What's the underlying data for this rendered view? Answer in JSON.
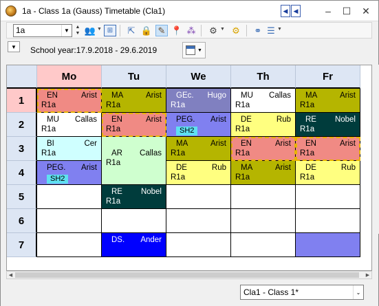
{
  "window": {
    "title": "1a - Class 1a (Gauss)  Timetable  (Cla1)",
    "nav_prev": "◀",
    "nav_next": "◀",
    "minimize": "–",
    "maximize": "☐",
    "close": "✕"
  },
  "toolbar": {
    "element_value": "1a",
    "icons": [
      "people-icon",
      "export-icon",
      "lock-icon",
      "edit-icon",
      "pin-icon",
      "molecule-icon",
      "settings-icon",
      "gear-icon",
      "binoculars-icon",
      "list-icon"
    ]
  },
  "info": {
    "school_year": "School year:17.9.2018 - 29.6.2019"
  },
  "timetable": {
    "days": [
      "Mo",
      "Tu",
      "We",
      "Th",
      "Fr"
    ],
    "periods": [
      "1",
      "2",
      "3",
      "4",
      "5",
      "6",
      "7"
    ],
    "lessons": [
      {
        "day": 0,
        "start": 0,
        "span": 1,
        "subject": "EN",
        "teacher": "Arist",
        "room": "R1a",
        "color": "#f08a84",
        "dashed": true
      },
      {
        "day": 0,
        "start": 1,
        "span": 1,
        "subject": "MU",
        "teacher": "Callas",
        "room": "R1a",
        "color": "#ffffff"
      },
      {
        "day": 0,
        "start": 2,
        "span": 1,
        "subject": "BI",
        "teacher": "Cer",
        "room": "R1a",
        "color": "#cfffff"
      },
      {
        "day": 0,
        "start": 3,
        "span": 1,
        "subject": "PEG.",
        "teacher": "Arist",
        "room": "",
        "tag": "SH2",
        "color": "#8080f0"
      },
      {
        "day": 1,
        "start": 0,
        "span": 1,
        "subject": "MA",
        "teacher": "Arist",
        "room": "R1a",
        "color": "#b5b500"
      },
      {
        "day": 1,
        "start": 1,
        "span": 1,
        "subject": "EN",
        "teacher": "Arist",
        "room": "R1a",
        "color": "#f08a84",
        "dashed": true
      },
      {
        "day": 1,
        "start": 2,
        "span": 2,
        "subject": "AR",
        "teacher": "Callas",
        "room": "R1a",
        "color": "#cfffcf"
      },
      {
        "day": 1,
        "start": 4,
        "span": 1,
        "subject": "RE",
        "teacher": "Nobel",
        "room": "R1a",
        "color": "#003c3c",
        "light": true
      },
      {
        "day": 1,
        "start": 6,
        "span": 1,
        "subject": "DS.",
        "teacher": "Ander",
        "room": "",
        "color": "#0000ff",
        "light": true
      },
      {
        "day": 2,
        "start": 0,
        "span": 1,
        "subject": "GEc.",
        "teacher": "Hugo",
        "room": "R1a",
        "color": "#8080c0",
        "light": true
      },
      {
        "day": 2,
        "start": 1,
        "span": 1,
        "subject": "PEG.",
        "teacher": "Arist",
        "room": "",
        "tag": "SH2",
        "color": "#8080f0"
      },
      {
        "day": 2,
        "start": 2,
        "span": 1,
        "subject": "MA",
        "teacher": "Arist",
        "room": "R1a",
        "color": "#b5b500"
      },
      {
        "day": 2,
        "start": 3,
        "span": 1,
        "subject": "DE",
        "teacher": "Rub",
        "room": "R1a",
        "color": "#ffff80"
      },
      {
        "day": 3,
        "start": 0,
        "span": 1,
        "subject": "MU",
        "teacher": "Callas",
        "room": "R1a",
        "color": "#ffffff"
      },
      {
        "day": 3,
        "start": 1,
        "span": 1,
        "subject": "DE",
        "teacher": "Rub",
        "room": "R1a",
        "color": "#ffff80"
      },
      {
        "day": 3,
        "start": 2,
        "span": 1,
        "subject": "EN",
        "teacher": "Arist",
        "room": "R1a",
        "color": "#f08a84",
        "dashed": true
      },
      {
        "day": 3,
        "start": 3,
        "span": 1,
        "subject": "MA",
        "teacher": "Arist",
        "room": "R1a",
        "color": "#b5b500"
      },
      {
        "day": 4,
        "start": 0,
        "span": 1,
        "subject": "MA",
        "teacher": "Arist",
        "room": "R1a",
        "color": "#b5b500"
      },
      {
        "day": 4,
        "start": 1,
        "span": 1,
        "subject": "RE",
        "teacher": "Nobel",
        "room": "R1a",
        "color": "#003c3c",
        "light": true
      },
      {
        "day": 4,
        "start": 2,
        "span": 1,
        "subject": "EN",
        "teacher": "Arist",
        "room": "R1a",
        "color": "#f08a84",
        "dashed": true
      },
      {
        "day": 4,
        "start": 3,
        "span": 1,
        "subject": "DE",
        "teacher": "Rub",
        "room": "R1a",
        "color": "#ffff80"
      },
      {
        "day": 4,
        "start": 6,
        "span": 1,
        "subject": "",
        "teacher": "",
        "room": "",
        "color": "#8080f0"
      }
    ]
  },
  "status": {
    "view_selector": "Cla1 - Class 1*"
  }
}
